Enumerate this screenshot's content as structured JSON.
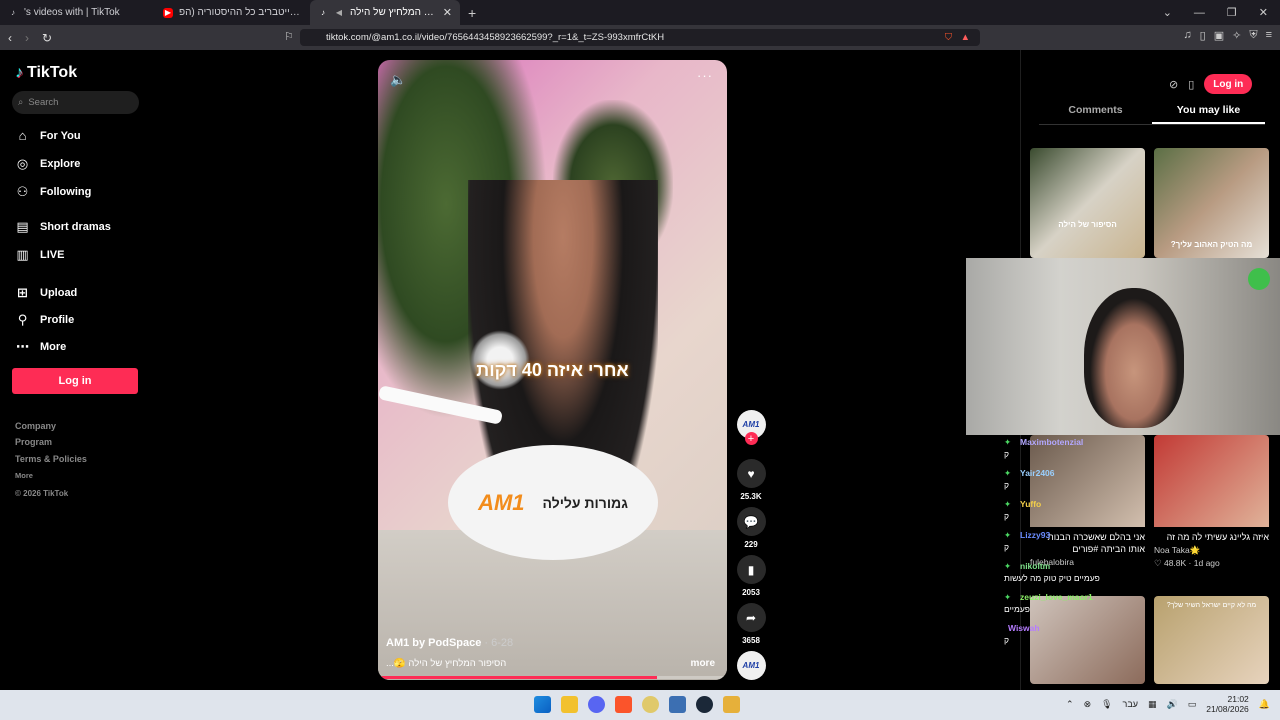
{
  "browser": {
    "tabs": [
      {
        "label": "'s videos with | TikTok",
        "icon": "tiktok-icon"
      },
      {
        "label": "אבא קריר אייטבריב כל ההיסטוריה (הפ",
        "icon": "youtube-icon"
      },
      {
        "label": "הסיפור המלחיץ של הילה — ",
        "icon": "tiktok-icon",
        "active": true
      }
    ],
    "url": "tiktok.com/@am1.co.il/video/7656443458923662599?_r=1&_t=ZS-993xmfrCtKH"
  },
  "sidebar": {
    "logo": "TikTok",
    "search_placeholder": "Search",
    "items": [
      {
        "label": "For You",
        "icon": "home-icon"
      },
      {
        "label": "Explore",
        "icon": "compass-icon"
      },
      {
        "label": "Following",
        "icon": "following-icon"
      },
      {
        "label": "Short dramas",
        "icon": "film-icon"
      },
      {
        "label": "LIVE",
        "icon": "live-icon"
      },
      {
        "label": "Upload",
        "icon": "upload-icon"
      },
      {
        "label": "Profile",
        "icon": "profile-icon"
      },
      {
        "label": "More",
        "icon": "more-icon"
      }
    ],
    "login": "Log in",
    "footer": [
      "Company",
      "Program",
      "Terms & Policies",
      "More",
      "© 2026 TikTok"
    ]
  },
  "video": {
    "caption_overlay": "אחרי איזה 40 דקות",
    "pillow_logo": "AM1",
    "pillow_text": "גמורות עלילה",
    "author": "AM1 by PodSpace",
    "date": "· 6-28",
    "description": "הסיפור המלחיץ של הילה 🫣...",
    "more": "more",
    "progress": 0.8,
    "actions": {
      "likes": "25.3K",
      "comments": "229",
      "saves": "2053",
      "shares": "3658"
    },
    "avatar_text": "AM1"
  },
  "right": {
    "login": "Log in",
    "tabs": [
      "Comments",
      "You may like"
    ],
    "cards": [
      {
        "thumb_text": "הסיפור של הילה",
        "title": "",
        "meta": ""
      },
      {
        "thumb_text": "מה הטיק האהוב עליך?",
        "title": "",
        "meta": ""
      },
      {
        "thumb_text": "",
        "title": "אני בהלם שאשכרה הבנות אותו הביתה #פורים",
        "meta": "fulebalobira"
      },
      {
        "thumb_text": "",
        "title": "איזה גליינג עשיתי לה מה זה",
        "meta_author": "Noa Taka🌟",
        "meta": "♡ 48.8K · 1d ago"
      }
    ],
    "bottom_thumb_text": "מה לא קיים ישראל השיר שלך?"
  },
  "stream_chat": [
    {
      "user": "Maximbotenzial",
      "msg": "ק"
    },
    {
      "user": "Yair2406",
      "msg": "ק"
    },
    {
      "user": "Yuffo",
      "msg": "ק"
    },
    {
      "user": "Lizzy93",
      "msg": "ק"
    },
    {
      "user": "nikoltm",
      "msg": "פעמיים טיק טוק מה לעשות"
    },
    {
      "user": "zeuzi_love_maor1",
      "msg": "פעמיים"
    },
    {
      "user": "Wiswah",
      "msg": "ק"
    }
  ],
  "taskbar": {
    "lang": "עבר",
    "time": "21:02",
    "date": "21/08/2026"
  },
  "colors": {
    "accent": "#fe2c55",
    "bg": "#000000"
  }
}
